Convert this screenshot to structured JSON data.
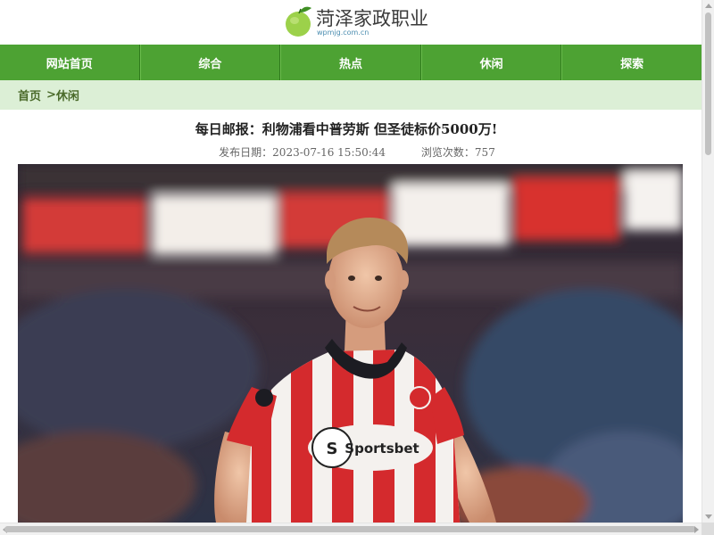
{
  "site": {
    "name": "菏泽家政职业",
    "domain": "wpmjg.com.cn",
    "logo_icon": "lemon-fruit-icon"
  },
  "nav": {
    "items": [
      {
        "label": "网站首页"
      },
      {
        "label": "综合"
      },
      {
        "label": "热点"
      },
      {
        "label": "休闲"
      },
      {
        "label": "探索"
      }
    ],
    "color": "#4da233"
  },
  "breadcrumb": {
    "home": "首页",
    "separator": ">",
    "current": "休闲"
  },
  "article": {
    "title": "每日邮报：利物浦看中普劳斯 但圣徒标价5000万!",
    "publish_label": "发布日期：",
    "publish_date": "2023-07-16 15:50:44",
    "views_label": "浏览次数：",
    "views": "757",
    "photo": {
      "jersey_sponsor": "Sportsbet"
    }
  },
  "colors": {
    "nav_bg": "#4da233",
    "breadcrumb_bg": "#dcefd6",
    "breadcrumb_text": "#4a6a2a",
    "domain_text": "#4b8db0"
  }
}
